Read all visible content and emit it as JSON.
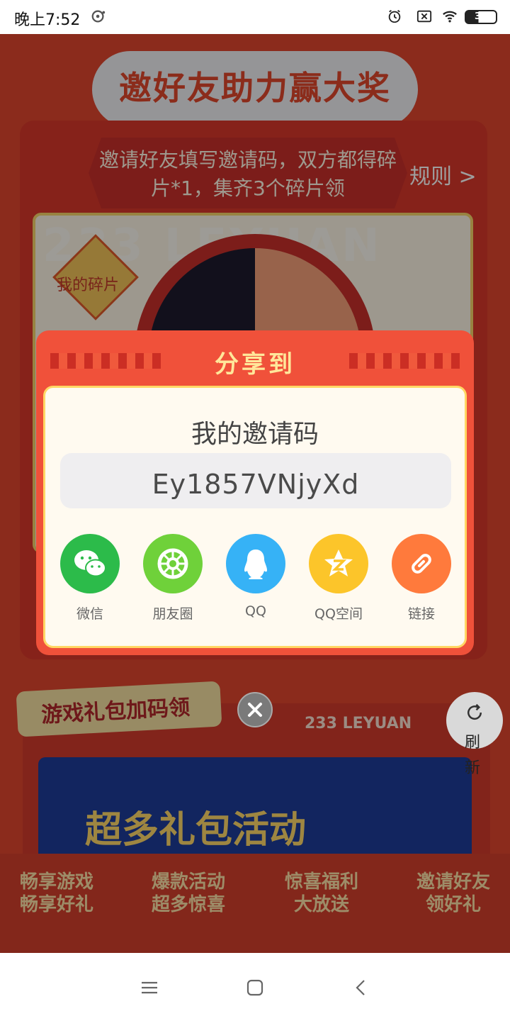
{
  "status_bar": {
    "time": "晚上7:52",
    "battery": "30"
  },
  "background": {
    "page_title": "邀好友助力赢大奖",
    "ribbon_text": "邀请好友填写邀请码，双方都得碎片*1，集齐3个碎片领",
    "rules_link": "规则 >",
    "fragment_label": "我的碎片",
    "brand_watermark": "233 LEYUAN",
    "game_gift_tag": "游戏礼包加码领",
    "brand_small": "233 LEYUAN",
    "banner_text": "超多礼包活动",
    "refresh_label": "刷新",
    "features": [
      {
        "line1": "畅享游戏",
        "line2": "畅享好礼"
      },
      {
        "line1": "爆款活动",
        "line2": "超多惊喜"
      },
      {
        "line1": "惊喜福利",
        "line2": "大放送"
      },
      {
        "line1": "邀请好友",
        "line2": "领好礼"
      }
    ]
  },
  "dialog": {
    "title": "分享到",
    "subtitle": "我的邀请码",
    "invite_code": "Ey1857VNjyXd",
    "share_targets": [
      {
        "label": "微信",
        "color": "#2cbb4a",
        "icon": "wechat-icon"
      },
      {
        "label": "朋友圈",
        "color": "#6fd13a",
        "icon": "moments-icon"
      },
      {
        "label": "QQ",
        "color": "#36b2f6",
        "icon": "qq-icon"
      },
      {
        "label": "QQ空间",
        "color": "#fcc52a",
        "icon": "qzone-icon"
      },
      {
        "label": "链接",
        "color": "#ff7a3c",
        "icon": "link-icon"
      }
    ]
  },
  "colors": {
    "dialog_red": "#f0513a",
    "title_yellow": "#ffe79a",
    "page_red": "#e0462e"
  }
}
